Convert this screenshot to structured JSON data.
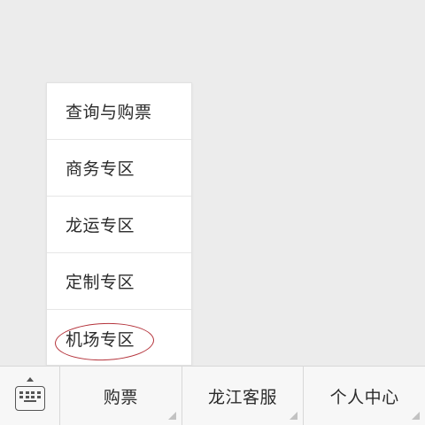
{
  "submenu": {
    "items": [
      {
        "label": "查询与购票"
      },
      {
        "label": "商务专区"
      },
      {
        "label": "龙运专区"
      },
      {
        "label": "定制专区"
      },
      {
        "label": "机场专区",
        "highlighted": true
      }
    ],
    "highlight_color": "#b4323a"
  },
  "bottom_bar": {
    "keyboard_icon": "keyboard-icon",
    "menus": [
      {
        "label": "购票"
      },
      {
        "label": "龙江客服"
      },
      {
        "label": "个人中心"
      }
    ]
  }
}
